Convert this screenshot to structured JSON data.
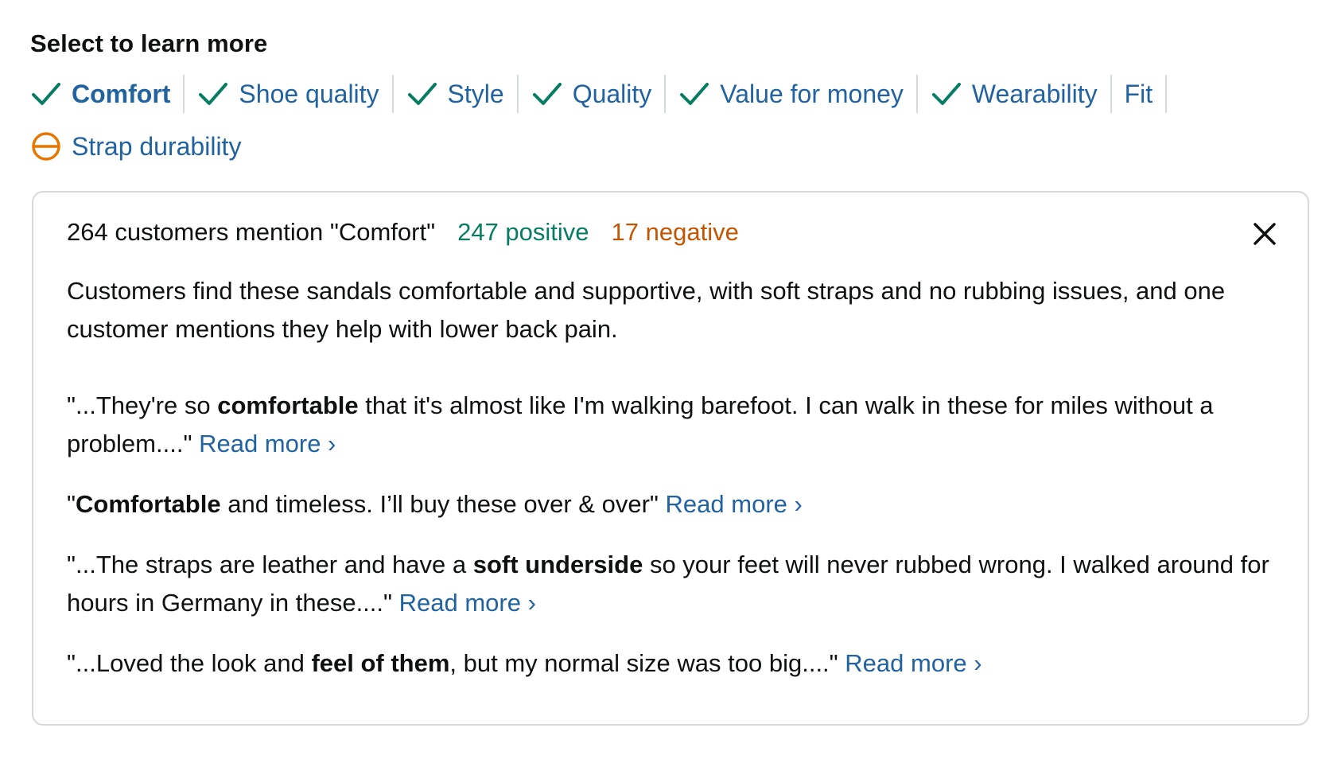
{
  "heading": "Select to learn more",
  "aspects": [
    {
      "label": "Comfort",
      "icon": "check-icon",
      "sentiment": "positive",
      "selected": true
    },
    {
      "label": "Shoe quality",
      "icon": "check-icon",
      "sentiment": "positive"
    },
    {
      "label": "Style",
      "icon": "check-icon",
      "sentiment": "positive"
    },
    {
      "label": "Quality",
      "icon": "check-icon",
      "sentiment": "positive"
    },
    {
      "label": "Value for money",
      "icon": "check-icon",
      "sentiment": "positive"
    },
    {
      "label": "Wearability",
      "icon": "check-icon",
      "sentiment": "positive"
    },
    {
      "label": "Fit",
      "icon": "none",
      "sentiment": "neutral"
    },
    {
      "label": "Strap durability",
      "icon": "mixed-icon",
      "sentiment": "mixed"
    }
  ],
  "panel": {
    "mention_text": "264 customers mention \"Comfort\"",
    "positive_text": "247 positive",
    "negative_text": "17 negative",
    "description": "Customers find these sandals comfortable and supportive, with soft straps and no rubbing issues, and one customer mentions they help with lower back pain.",
    "quotes": [
      {
        "before": "\"...They're so ",
        "bold": "comfortable",
        "after": " that it's almost like I'm walking barefoot. I can walk in these for miles without a problem....\" ",
        "link": "Read more ›"
      },
      {
        "before": "\"",
        "bold": "Comfortable",
        "after": " and timeless. I’ll buy these over & over\" ",
        "link": "Read more ›"
      },
      {
        "before": "\"...The straps are leather and have a ",
        "bold": "soft underside",
        "after": " so your feet will never rubbed wrong. I walked around for hours in Germany in these....\" ",
        "link": "Read more ›"
      },
      {
        "before": "\"...Loved the look and ",
        "bold": "feel of them",
        "after": ", but my normal size was too big....\" ",
        "link": "Read more ›"
      }
    ]
  },
  "colors": {
    "link": "#2162a1",
    "positive": "#067d62",
    "negative": "#c45500",
    "check": "#067d62",
    "mixed": "#e77600",
    "border": "#d5d9d9"
  }
}
